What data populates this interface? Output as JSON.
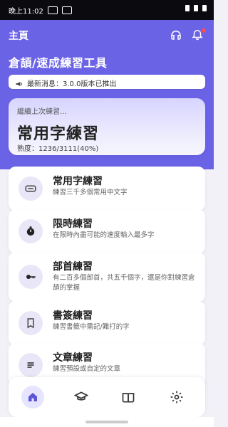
{
  "status": {
    "time": "晚上11:02"
  },
  "header": {
    "page_title": "主頁",
    "app_title": "倉頡/速成練習工具",
    "notice": "最新消息：3.0.0版本已推出"
  },
  "last_practice": {
    "hint": "繼續上次練習...",
    "title": "常用字練習",
    "progress_text": "熟度：1236/3111(40%)",
    "progress_fraction": 0.4
  },
  "cards": [
    {
      "icon": "keyboard-icon",
      "title": "常用字練習",
      "desc": "練習三千多個常用中文字"
    },
    {
      "icon": "timer-icon",
      "title": "限時練習",
      "desc": "在限時內盡可能的速度輸入最多字"
    },
    {
      "icon": "key-icon",
      "title": "部首練習",
      "desc": "有二百多個部首，共五千個字，還是你對練習倉頡的掌握"
    },
    {
      "icon": "bookmark-icon",
      "title": "書簽練習",
      "desc": "練習書籤中需記/難打的字"
    },
    {
      "icon": "lines-icon",
      "title": "文章練習",
      "desc": "練習預設或自定的文章"
    }
  ],
  "nav": [
    {
      "name": "home",
      "icon": "home-icon"
    },
    {
      "name": "learn",
      "icon": "graduation-cap-icon"
    },
    {
      "name": "book",
      "icon": "book-icon"
    },
    {
      "name": "settings",
      "icon": "gear-icon"
    }
  ],
  "colors": {
    "primary": "#6b63e6",
    "bg": "#f3f1f8"
  }
}
